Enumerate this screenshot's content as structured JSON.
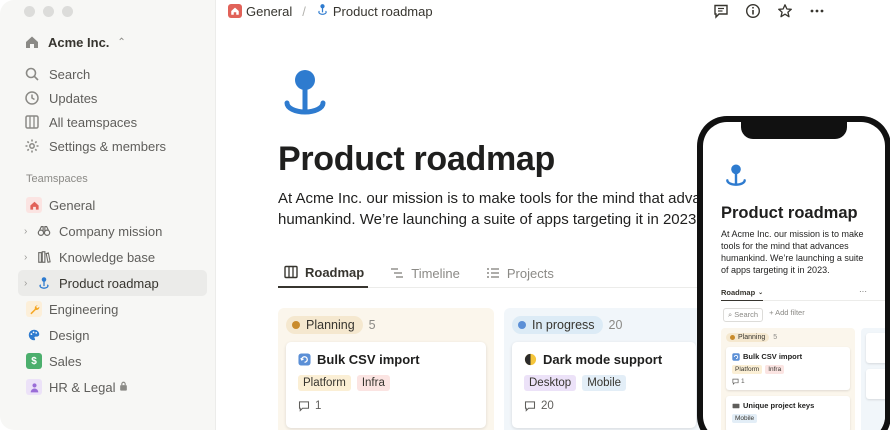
{
  "sidebar": {
    "workspace": "Acme Inc.",
    "nav": [
      {
        "label": "Search",
        "icon": "search-icon"
      },
      {
        "label": "Updates",
        "icon": "clock-icon"
      },
      {
        "label": "All teamspaces",
        "icon": "grid-icon"
      },
      {
        "label": "Settings & members",
        "icon": "gear-icon"
      }
    ],
    "teamspaces_label": "Teamspaces",
    "teams": [
      {
        "label": "General",
        "icon": "home-icon",
        "color": "#e16259"
      },
      {
        "label": "Company mission",
        "icon": "binoculars-icon"
      },
      {
        "label": "Knowledge base",
        "icon": "books-icon"
      },
      {
        "label": "Product roadmap",
        "icon": "pin-icon"
      },
      {
        "label": "Engineering",
        "icon": "wrench-icon",
        "color": "#f5a623"
      },
      {
        "label": "Design",
        "icon": "palette-icon",
        "color": "#2e7bcf"
      },
      {
        "label": "Sales",
        "icon": "dollar-icon",
        "color": "#4caf6d"
      },
      {
        "label": "HR & Legal",
        "icon": "person-icon",
        "color": "#9a6dd7"
      }
    ]
  },
  "breadcrumb": {
    "first": "General",
    "second": "Product roadmap"
  },
  "page": {
    "title": "Product roadmap",
    "description_line1": "At Acme Inc. our mission is to make tools for the mind that advanc",
    "description_line2": "humankind. We’re launching a suite of apps targeting it in 2023.",
    "tabs": [
      "Roadmap",
      "Timeline",
      "Projects"
    ]
  },
  "board": {
    "planning": {
      "label": "Planning",
      "count": "5",
      "card": {
        "title": "Bulk CSV import",
        "tags": [
          "Platform",
          "Infra"
        ],
        "comments": "1"
      }
    },
    "progress": {
      "label": "In progress",
      "count": "20",
      "card": {
        "title": "Dark mode support",
        "tags": [
          "Desktop",
          "Mobile"
        ],
        "comments": "20"
      }
    }
  },
  "phone": {
    "title": "Product roadmap",
    "description": "At Acme Inc. our mission is to make tools for the mind that advances humankind. We’re launching a suite of apps targeting it in 2023.",
    "tab": "Roadmap",
    "more": "···",
    "search": "Search",
    "add_filter": "+ Add filter",
    "planning_label": "Planning",
    "planning_count": "5",
    "card1": {
      "title": "Bulk CSV import",
      "tags": [
        "Platform",
        "Infra"
      ],
      "comments": "1"
    },
    "card2": {
      "title": "Unique project keys",
      "tags": [
        "Mobile"
      ]
    }
  },
  "colors": {
    "accent_blue": "#2e7bcf",
    "planning_bg": "#fbf6ec",
    "progress_bg": "#f1f6fa"
  }
}
